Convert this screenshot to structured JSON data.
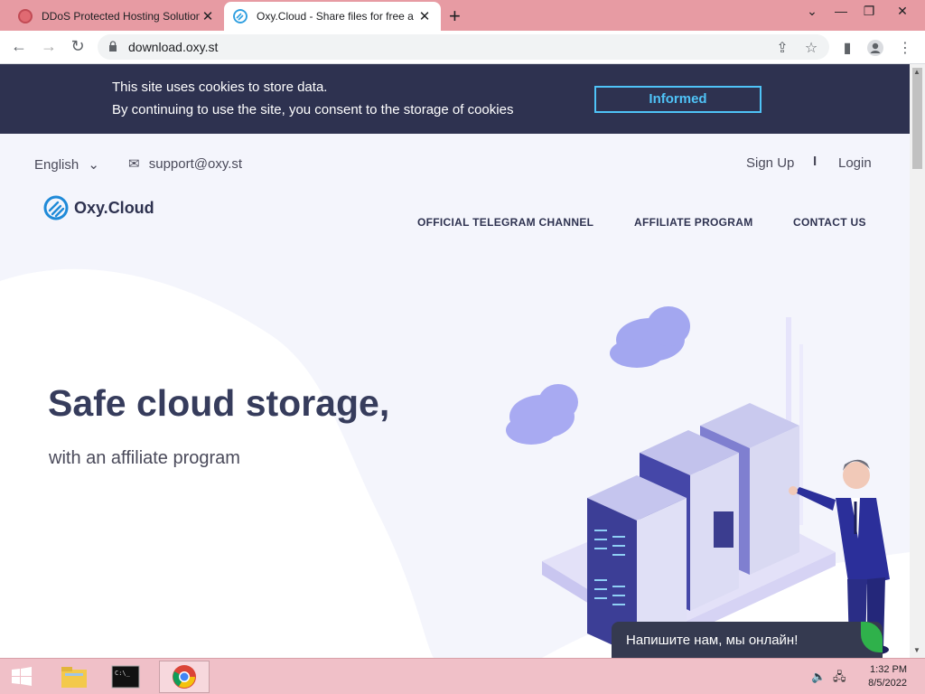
{
  "browser": {
    "tabs": [
      {
        "title": "DDoS Protected Hosting Solution",
        "active": false
      },
      {
        "title": "Oxy.Cloud - Share files for free a",
        "active": true
      }
    ],
    "new_tab": "+",
    "url": "download.oxy.st"
  },
  "cookie_banner": {
    "line1": "This site uses cookies to store data.",
    "line2": "By continuing to use the site, you consent to the storage of cookies",
    "button": "Informed"
  },
  "header": {
    "language": "English",
    "email": "support@oxy.st",
    "sign_up": "Sign Up",
    "separator": "I",
    "login": "Login",
    "logo_text": "Oxy.Cloud",
    "nav": [
      "OFFICIAL TELEGRAM CHANNEL",
      "AFFILIATE PROGRAM",
      "CONTACT US"
    ]
  },
  "hero": {
    "title": "Safe cloud storage,",
    "subtitle": "with an affiliate program"
  },
  "chat_widget": {
    "text": "Напишите нам, мы онлайн!"
  },
  "taskbar": {
    "time": "1:32 PM",
    "date": "8/5/2022"
  },
  "colors": {
    "banner_bg": "#2e3250",
    "accent": "#4fc3f7",
    "hero_title": "#363c5c",
    "tabstrip": "#e79ba3"
  }
}
